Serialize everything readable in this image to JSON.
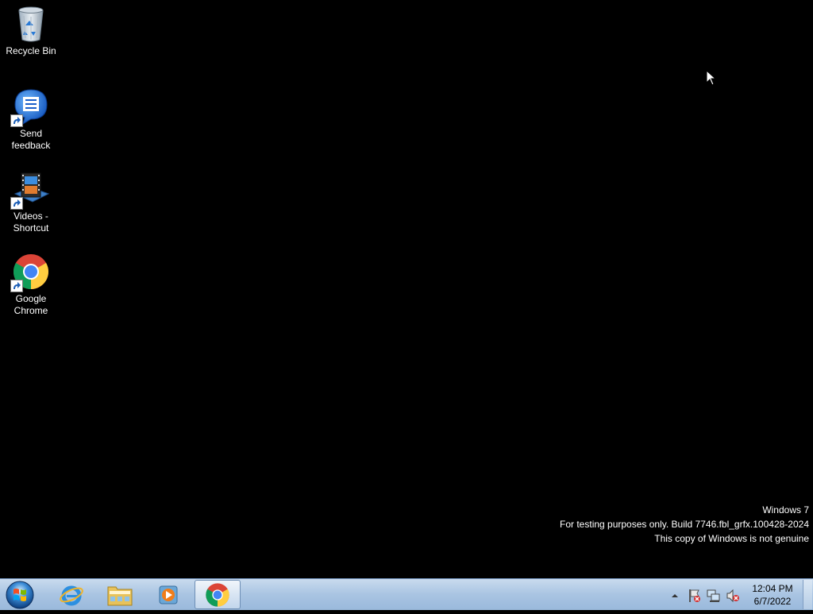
{
  "desktop": {
    "icons": [
      {
        "label": "Recycle Bin",
        "icon": "recycle-bin-icon",
        "shortcut": false
      },
      {
        "label": "Send feedback",
        "icon": "feedback-icon",
        "shortcut": true
      },
      {
        "label": "Videos - Shortcut",
        "icon": "videos-icon",
        "shortcut": true
      },
      {
        "label": "Google Chrome",
        "icon": "chrome-icon",
        "shortcut": true
      }
    ]
  },
  "watermark": {
    "line1": "Windows 7",
    "line2": "For testing purposes only. Build 7746.fbl_grfx.100428-2024",
    "line3": "This copy of Windows is not genuine"
  },
  "taskbar": {
    "start_icon": "windows-start-orb-icon",
    "pinned": [
      {
        "name": "internet-explorer",
        "icon": "internet-explorer-icon"
      },
      {
        "name": "windows-explorer",
        "icon": "folder-icon"
      },
      {
        "name": "media-player",
        "icon": "media-player-icon"
      },
      {
        "name": "google-chrome",
        "icon": "chrome-icon",
        "active": true
      }
    ],
    "tray": {
      "icons": [
        "show-hidden-icons-arrow",
        "action-center-flag-icon",
        "network-icon",
        "volume-muted-icon"
      ],
      "time": "12:04 PM",
      "date": "6/7/2022"
    }
  },
  "colors": {
    "desktop_bg": "#000000",
    "taskbar_top": "#c9dbee",
    "taskbar_bottom": "#9ab9dc",
    "text_white": "#ffffff"
  }
}
